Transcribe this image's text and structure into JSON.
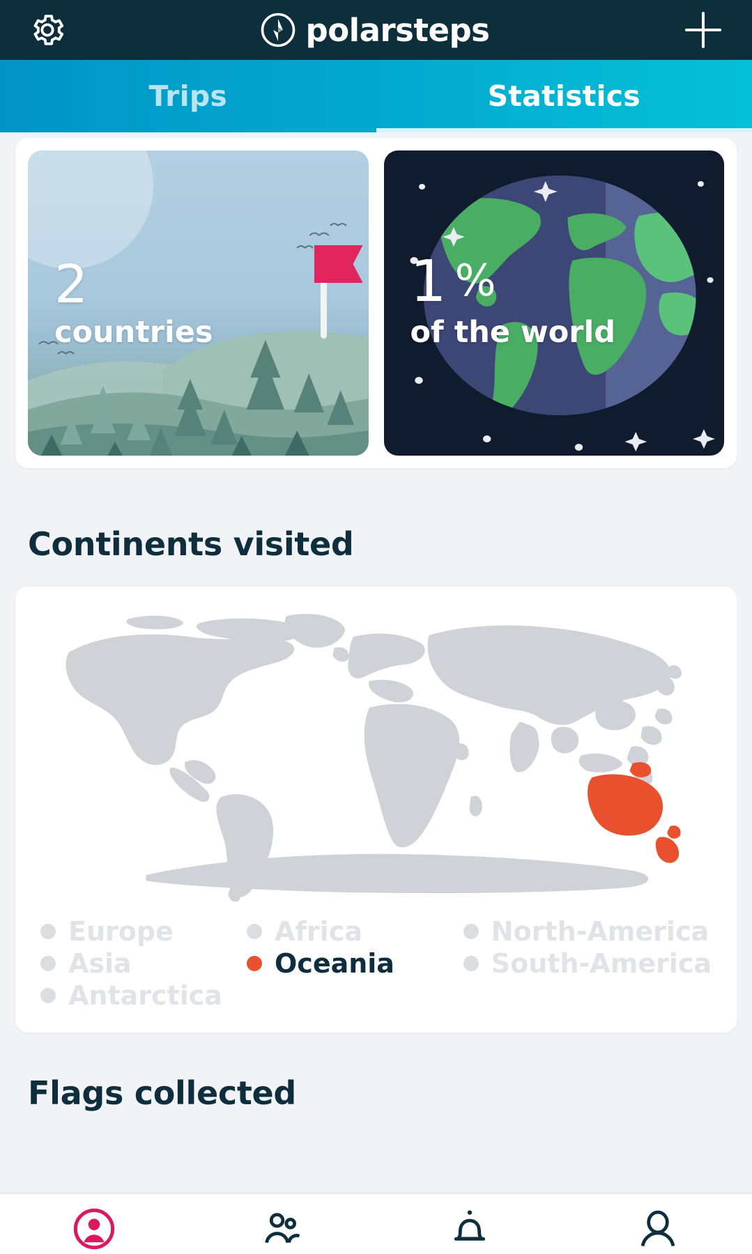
{
  "header": {
    "brand": "polarsteps",
    "settings_icon": "gear-icon",
    "add_icon": "plus-icon"
  },
  "tabs": [
    {
      "label": "Trips",
      "active": false
    },
    {
      "label": "Statistics",
      "active": true
    }
  ],
  "stats": {
    "countries": {
      "value": "2",
      "label": "countries"
    },
    "world": {
      "value": "1",
      "symbol": "%",
      "label": "of the world"
    }
  },
  "sections": {
    "continents_title": "Continents visited",
    "flags_title": "Flags collected"
  },
  "continents": {
    "column1": [
      {
        "name": "Europe",
        "visited": false
      },
      {
        "name": "Asia",
        "visited": false
      },
      {
        "name": "Antarctica",
        "visited": false
      }
    ],
    "column2": [
      {
        "name": "Africa",
        "visited": false
      },
      {
        "name": "Oceania",
        "visited": true
      }
    ],
    "column3": [
      {
        "name": "North-America",
        "visited": false
      },
      {
        "name": "South-America",
        "visited": false
      }
    ]
  },
  "colors": {
    "topbar": "#0d2f3c",
    "tab_left": "#0195c6",
    "tab_right": "#05c0d6",
    "visited": "#e8502e",
    "unvisited": "#dcdde1",
    "heading": "#0e2e3e",
    "accent_pink": "#d81b60",
    "page_bg": "#f2f3f7"
  },
  "bottom_nav": [
    {
      "icon": "profile-active-icon",
      "active": true
    },
    {
      "icon": "friends-icon",
      "active": false
    },
    {
      "icon": "bell-icon",
      "active": false
    },
    {
      "icon": "avatar-icon",
      "active": false
    }
  ]
}
